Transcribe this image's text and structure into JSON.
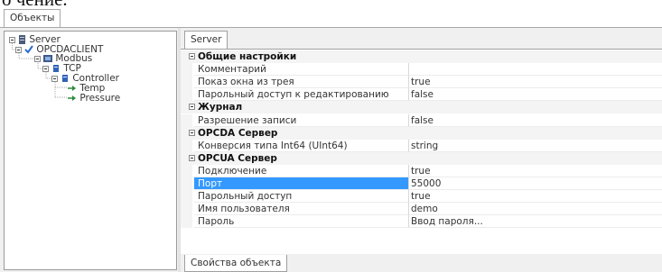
{
  "crop_text": "o чение.",
  "window_tab": "Объекты",
  "tree": {
    "nodes": [
      {
        "label": "Server",
        "icon": "server-icon"
      },
      {
        "label": "OPCDACLIENT",
        "icon": "check-icon"
      },
      {
        "label": "Modbus",
        "icon": "modbus-icon"
      },
      {
        "label": "TCP",
        "icon": "network-icon"
      },
      {
        "label": "Controller",
        "icon": "controller-icon"
      },
      {
        "label": "Temp",
        "icon": "tag-icon"
      },
      {
        "label": "Pressure",
        "icon": "tag-icon"
      }
    ]
  },
  "properties_tab": "Server",
  "bottom_tab": "Свойства объекта",
  "categories": [
    {
      "label": "Общие настройки",
      "rows": [
        {
          "name": "Комментарий",
          "value": ""
        },
        {
          "name": "Показ окна из трея",
          "value": "true"
        },
        {
          "name": "Парольный доступ к редактированию",
          "value": "false"
        }
      ]
    },
    {
      "label": "Журнал",
      "rows": [
        {
          "name": "Разрешение записи",
          "value": "false"
        }
      ]
    },
    {
      "label": "OPCDA Сервер",
      "rows": [
        {
          "name": "Конверсия типа Int64 (UInt64)",
          "value": "string"
        }
      ]
    },
    {
      "label": "OPCUA Сервер",
      "rows": [
        {
          "name": "Подключение",
          "value": "true"
        },
        {
          "name": "Порт",
          "value": "55000",
          "selected": true
        },
        {
          "name": "Парольный доступ",
          "value": "true"
        },
        {
          "name": "Имя пользователя",
          "value": "demo"
        },
        {
          "name": "Пароль",
          "value": "Ввод пароля..."
        }
      ]
    }
  ],
  "colors": {
    "selection": "#3399ff",
    "panel": "#f0f0f0"
  }
}
